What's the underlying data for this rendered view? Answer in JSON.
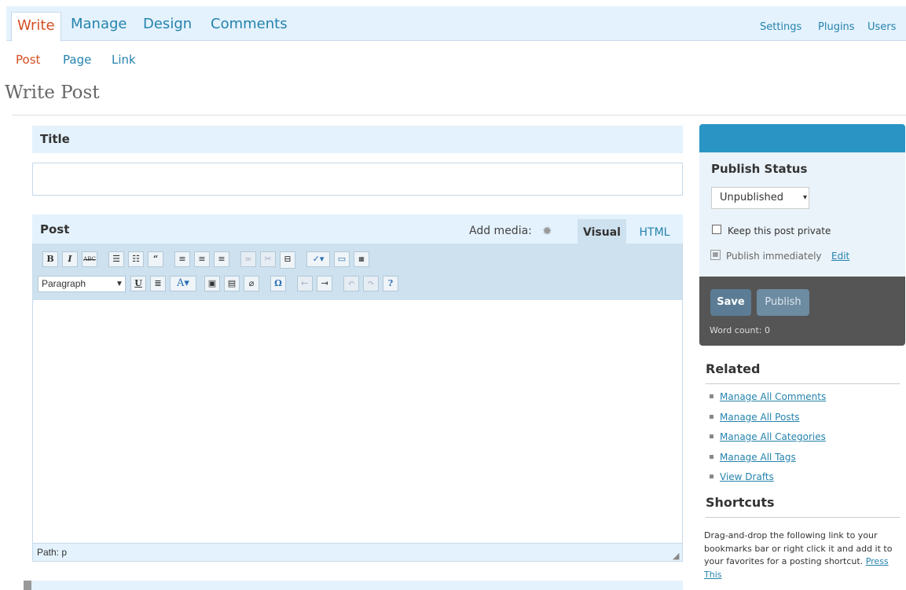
{
  "nav": {
    "main_tabs": [
      "Write",
      "Manage",
      "Design",
      "Comments"
    ],
    "right_links": [
      "Settings",
      "Plugins",
      "Users"
    ]
  },
  "subnav": [
    "Post",
    "Page",
    "Link"
  ],
  "page_title": "Write Post",
  "title_box": {
    "label": "Title",
    "value": ""
  },
  "post_box": {
    "label": "Post",
    "add_media": "Add media:",
    "tab_visual": "Visual",
    "tab_html": "HTML",
    "format_selected": "Paragraph",
    "path": "Path: p"
  },
  "toolbar_icons": {
    "row1": [
      "bold-icon",
      "italic-icon",
      "strikethrough-icon",
      "bullet-list-icon",
      "numbered-list-icon",
      "blockquote-icon",
      "align-left-icon",
      "align-center-icon",
      "align-right-icon",
      "link-icon",
      "unlink-icon",
      "more-tag-icon",
      "spellcheck-icon",
      "fullscreen-icon",
      "kitchen-sink-icon"
    ],
    "row2": [
      "underline-icon",
      "justify-icon",
      "text-color-icon",
      "paste-text-icon",
      "paste-word-icon",
      "remove-format-icon",
      "special-char-icon",
      "outdent-icon",
      "indent-icon",
      "undo-icon",
      "redo-icon",
      "help-icon"
    ]
  },
  "publish": {
    "status_label": "Publish Status",
    "status_value": "Unpublished",
    "private_label": "Keep this post private",
    "private_checked": false,
    "when": "Publish immediately",
    "edit_link": "Edit",
    "save_label": "Save",
    "publish_label": "Publish",
    "word_count": "Word count: 0"
  },
  "related": {
    "heading": "Related",
    "links": [
      "Manage All Comments",
      "Manage All Posts",
      "Manage All Categories",
      "Manage All Tags",
      "View Drafts"
    ]
  },
  "shortcuts": {
    "heading": "Shortcuts",
    "text": "Drag-and-drop the following link to your bookmarks bar or right click it and add it to your favorites for a posting shortcut.",
    "link": "Press This"
  },
  "colors": {
    "accent": "#2583ad",
    "active_orange": "#d54e21",
    "nav_bg": "#e4f2fd",
    "sidebar_top": "#2a95c5",
    "sidebar_dark": "#555555"
  }
}
